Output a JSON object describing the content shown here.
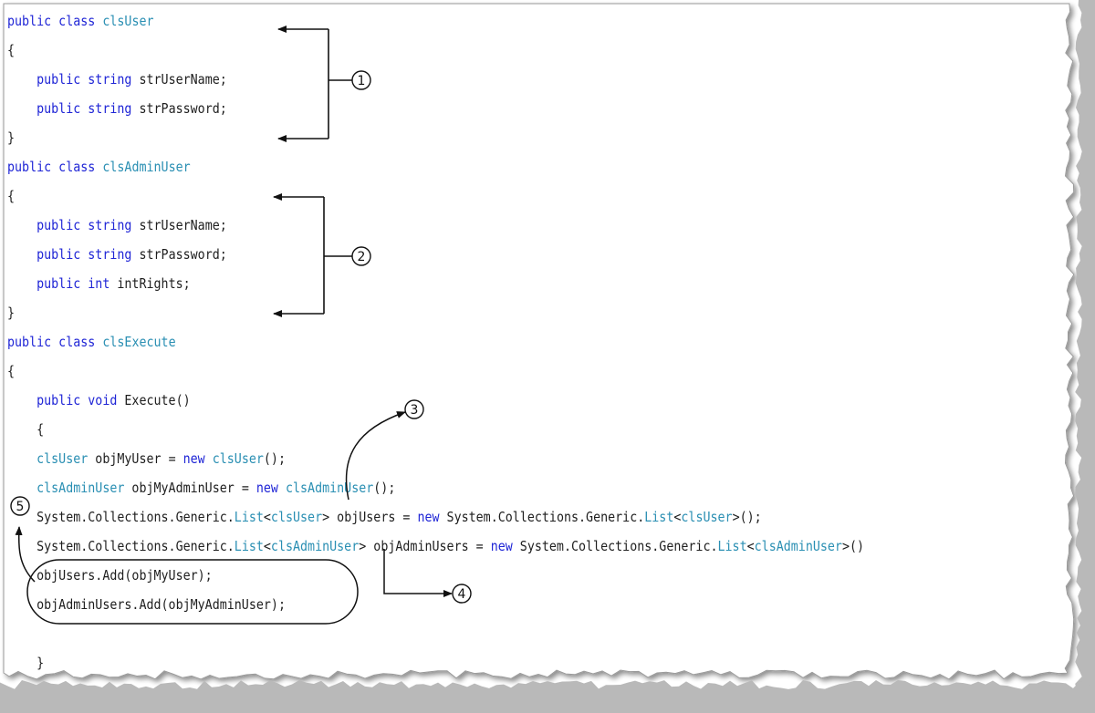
{
  "code_lines": [
    {
      "indent": 0,
      "tokens": [
        {
          "t": "public class ",
          "c": "kw"
        },
        {
          "t": "clsUser",
          "c": "type"
        }
      ]
    },
    {
      "indent": 0,
      "tokens": [
        {
          "t": "{",
          "c": "plain"
        }
      ]
    },
    {
      "indent": 1,
      "tokens": [
        {
          "t": "public string ",
          "c": "kw"
        },
        {
          "t": "strUserName;",
          "c": "plain"
        }
      ]
    },
    {
      "indent": 1,
      "tokens": [
        {
          "t": "public string ",
          "c": "kw"
        },
        {
          "t": "strPassword;",
          "c": "plain"
        }
      ]
    },
    {
      "indent": 0,
      "tokens": [
        {
          "t": "}",
          "c": "plain"
        }
      ]
    },
    {
      "indent": 0,
      "tokens": [
        {
          "t": "public class ",
          "c": "kw"
        },
        {
          "t": "clsAdminUser",
          "c": "type"
        }
      ]
    },
    {
      "indent": 0,
      "tokens": [
        {
          "t": "{",
          "c": "plain"
        }
      ]
    },
    {
      "indent": 1,
      "tokens": [
        {
          "t": "public string ",
          "c": "kw"
        },
        {
          "t": "strUserName;",
          "c": "plain"
        }
      ]
    },
    {
      "indent": 1,
      "tokens": [
        {
          "t": "public string ",
          "c": "kw"
        },
        {
          "t": "strPassword;",
          "c": "plain"
        }
      ]
    },
    {
      "indent": 1,
      "tokens": [
        {
          "t": "public int ",
          "c": "kw"
        },
        {
          "t": "intRights;",
          "c": "plain"
        }
      ]
    },
    {
      "indent": 0,
      "tokens": [
        {
          "t": "}",
          "c": "plain"
        }
      ]
    },
    {
      "indent": 0,
      "tokens": [
        {
          "t": "public class ",
          "c": "kw"
        },
        {
          "t": "clsExecute",
          "c": "type"
        }
      ]
    },
    {
      "indent": 0,
      "tokens": [
        {
          "t": "{",
          "c": "plain"
        }
      ]
    },
    {
      "indent": 1,
      "tokens": [
        {
          "t": "public void ",
          "c": "kw"
        },
        {
          "t": "Execute()",
          "c": "plain"
        }
      ]
    },
    {
      "indent": 1,
      "tokens": [
        {
          "t": "{",
          "c": "plain"
        }
      ]
    },
    {
      "indent": 1,
      "tokens": [
        {
          "t": "clsUser",
          "c": "type"
        },
        {
          "t": " objMyUser = ",
          "c": "plain"
        },
        {
          "t": "new ",
          "c": "kw"
        },
        {
          "t": "clsUser",
          "c": "type"
        },
        {
          "t": "();",
          "c": "plain"
        }
      ]
    },
    {
      "indent": 1,
      "tokens": [
        {
          "t": "clsAdminUser",
          "c": "type"
        },
        {
          "t": " objMyAdminUser = ",
          "c": "plain"
        },
        {
          "t": "new ",
          "c": "kw"
        },
        {
          "t": "clsAdminUser",
          "c": "type"
        },
        {
          "t": "();",
          "c": "plain"
        }
      ]
    },
    {
      "indent": 1,
      "tokens": [
        {
          "t": "System.Collections.Generic.",
          "c": "plain"
        },
        {
          "t": "List",
          "c": "type"
        },
        {
          "t": "<",
          "c": "plain"
        },
        {
          "t": "clsUser",
          "c": "type"
        },
        {
          "t": "> objUsers = ",
          "c": "plain"
        },
        {
          "t": "new ",
          "c": "kw"
        },
        {
          "t": "System.Collections.Generic.",
          "c": "plain"
        },
        {
          "t": "List",
          "c": "type"
        },
        {
          "t": "<",
          "c": "plain"
        },
        {
          "t": "clsUser",
          "c": "type"
        },
        {
          "t": ">();",
          "c": "plain"
        }
      ]
    },
    {
      "indent": 1,
      "tokens": [
        {
          "t": "System.Collections.Generic.",
          "c": "plain"
        },
        {
          "t": "List",
          "c": "type"
        },
        {
          "t": "<",
          "c": "plain"
        },
        {
          "t": "clsAdminUser",
          "c": "type"
        },
        {
          "t": "> objAdminUsers = ",
          "c": "plain"
        },
        {
          "t": "new ",
          "c": "kw"
        },
        {
          "t": "System.Collections.Generic.",
          "c": "plain"
        },
        {
          "t": "List",
          "c": "type"
        },
        {
          "t": "<",
          "c": "plain"
        },
        {
          "t": "clsAdminUser",
          "c": "type"
        },
        {
          "t": ">()",
          "c": "plain"
        }
      ]
    },
    {
      "indent": 1,
      "tokens": [
        {
          "t": "objUsers.Add(objMyUser);",
          "c": "plain"
        }
      ]
    },
    {
      "indent": 1,
      "tokens": [
        {
          "t": "objAdminUsers.Add(objMyAdminUser);",
          "c": "plain"
        }
      ]
    },
    {
      "indent": 0,
      "tokens": []
    },
    {
      "indent": 1,
      "tokens": [
        {
          "t": "}",
          "c": "plain"
        }
      ]
    }
  ],
  "callouts": {
    "c1": "1",
    "c2": "2",
    "c3": "3",
    "c4": "4",
    "c5": "5"
  },
  "colors": {
    "keyword": "#1f25d6",
    "type": "#2a8fb3",
    "plain": "#1e1e1e",
    "frame_gray": "#b5b5b5",
    "annotation": "#111111"
  }
}
